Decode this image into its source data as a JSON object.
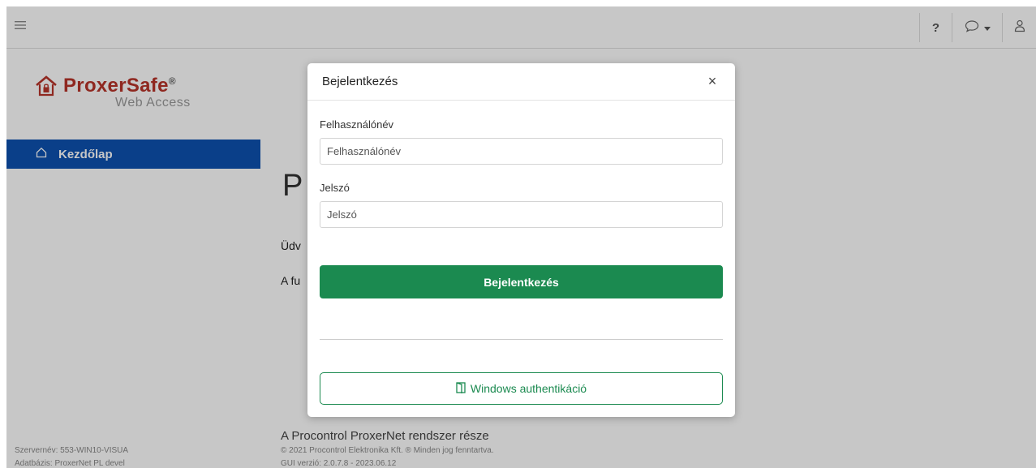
{
  "header": {
    "help_label": "?"
  },
  "brand": {
    "name": "ProxerSafe",
    "registered": "®",
    "subtitle": "Web Access",
    "color": "#b8342a"
  },
  "sidebar": {
    "home_label": "Kezdőlap",
    "active_color": "#0d51b0",
    "server_name": "Szervernév: 553-WIN10-VISUA",
    "db_name": "Adatbázis: ProxerNet PL devel"
  },
  "main": {
    "title_partial": "P",
    "welcome_partial": "Üdv",
    "func_partial": "A fu"
  },
  "footer": {
    "main": "A Procontrol ProxerNet rendszer része",
    "copyright": "© 2021 Procontrol Elektronika Kft. ® Minden jog fenntartva.",
    "version": "GUI verzió: 2.0.7.8 - 2023.06.12"
  },
  "modal": {
    "title": "Bejelentkezés",
    "close_label": "×",
    "username": {
      "label": "Felhasználónév",
      "placeholder": "Felhasználónév",
      "value": ""
    },
    "password": {
      "label": "Jelszó",
      "placeholder": "Jelszó",
      "value": ""
    },
    "login_button": "Bejelentkezés",
    "windows_button": "Windows authentikáció",
    "accent_color": "#1b8a50"
  }
}
